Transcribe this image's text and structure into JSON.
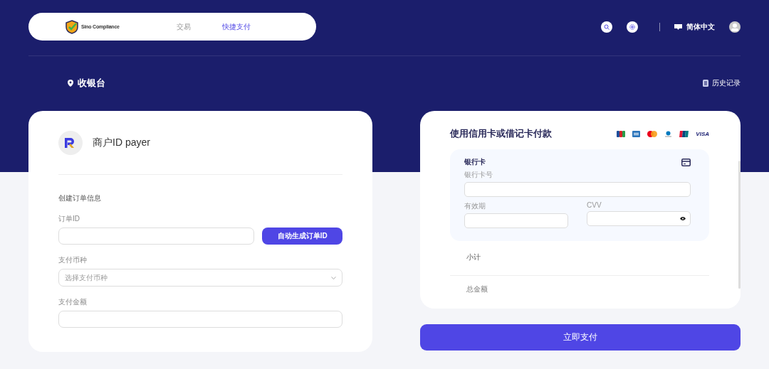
{
  "header": {
    "brand": {
      "name": "Sino Compliance"
    },
    "tabs": [
      {
        "label": "交易",
        "selected": false
      },
      {
        "label": "快捷支付",
        "selected": true
      }
    ],
    "language": "简体中文"
  },
  "page_title": "收银台",
  "history_link": "历史记录",
  "merchant": {
    "name": "商户ID payer"
  },
  "order_form": {
    "title": "创建订单信息",
    "fields": [
      {
        "kind": "text-with-button",
        "label": "订单ID",
        "button": "自动生成订单ID"
      },
      {
        "kind": "select",
        "label": "支付币种",
        "placeholder": "选择支付币种"
      },
      {
        "kind": "text",
        "label": "支付金额"
      }
    ]
  },
  "payment": {
    "title": "使用信用卡或借记卡付款",
    "card_brands": [
      {
        "kind": "jcb"
      },
      {
        "kind": "amex"
      },
      {
        "kind": "mastercard"
      },
      {
        "kind": "diners"
      },
      {
        "kind": "unionpay"
      },
      {
        "kind": "visa",
        "label": "VISA"
      }
    ],
    "bank_card": {
      "title": "银行卡",
      "number_label": "银行卡号",
      "expiry_label": "有效期",
      "cvv_label": "CVV"
    },
    "summary": [
      {
        "label": "小计"
      },
      {
        "label": "总金额"
      }
    ]
  },
  "pay_button": "立即支付"
}
